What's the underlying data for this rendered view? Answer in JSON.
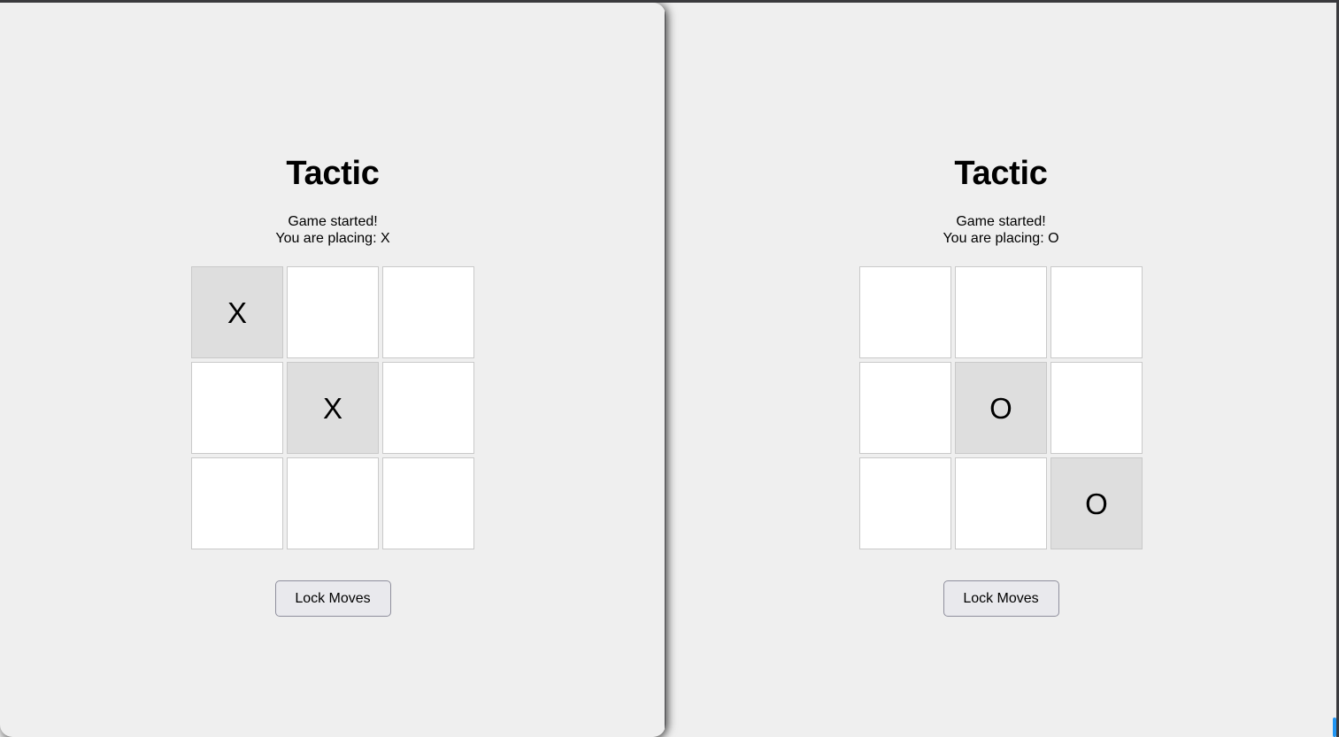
{
  "window": {
    "accent_color": "#2196f3",
    "background_color": "#efefef",
    "border_color": "#3a3a3d"
  },
  "panels": [
    {
      "id": "left",
      "title": "Tactic",
      "status": {
        "line1": "Game started!",
        "line2": "You are placing: X"
      },
      "player_symbol": "X",
      "board": {
        "rows": 3,
        "cols": 3,
        "cells": [
          [
            "X",
            "",
            ""
          ],
          [
            "",
            "X",
            ""
          ],
          [
            "",
            "",
            ""
          ]
        ],
        "empty_cell_color": "#ffffff",
        "filled_cell_color": "#dedede",
        "border_color": "#c9c9c9"
      },
      "lock_button_label": "Lock Moves"
    },
    {
      "id": "right",
      "title": "Tactic",
      "status": {
        "line1": "Game started!",
        "line2": "You are placing: O"
      },
      "player_symbol": "O",
      "board": {
        "rows": 3,
        "cols": 3,
        "cells": [
          [
            "",
            "",
            ""
          ],
          [
            "",
            "O",
            ""
          ],
          [
            "",
            "",
            "O"
          ]
        ],
        "empty_cell_color": "#ffffff",
        "filled_cell_color": "#dedede",
        "border_color": "#c9c9c9"
      },
      "lock_button_label": "Lock Moves"
    }
  ]
}
